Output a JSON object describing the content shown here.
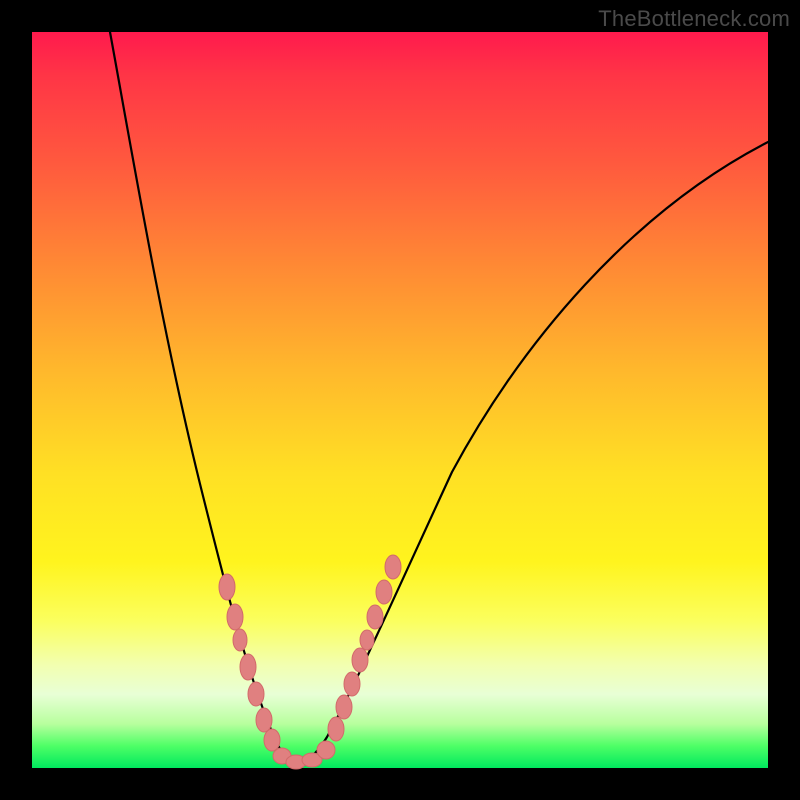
{
  "watermark": "TheBottleneck.com",
  "colors": {
    "frame": "#000000",
    "gradient_top": "#ff1a4d",
    "gradient_bottom": "#00e85e",
    "curve": "#000000",
    "bead": "#e08080"
  },
  "chart_data": {
    "type": "line",
    "title": "",
    "xlabel": "",
    "ylabel": "",
    "xlim": [
      0,
      100
    ],
    "ylim": [
      0,
      100
    ],
    "x": [
      0,
      2,
      4,
      6,
      8,
      10,
      12,
      14,
      16,
      18,
      20,
      22,
      24,
      26,
      27,
      28,
      29,
      30,
      31,
      32,
      33,
      34,
      35,
      36,
      38,
      40,
      42,
      45,
      48,
      52,
      56,
      60,
      64,
      68,
      72,
      76,
      80,
      84,
      88,
      92,
      96,
      100
    ],
    "values": [
      100,
      92,
      84,
      76,
      68,
      60,
      52,
      45,
      38,
      32,
      26,
      20,
      15,
      10,
      8,
      6,
      4,
      2.5,
      1.2,
      0.5,
      0.2,
      0,
      0.3,
      1,
      3,
      6,
      10,
      14,
      19,
      25,
      31,
      37,
      43,
      49,
      55,
      60,
      65,
      70,
      74,
      78,
      82,
      85
    ],
    "annotations": {
      "bead_cluster_left_x_range": [
        23,
        30
      ],
      "bead_cluster_right_x_range": [
        36,
        44
      ],
      "bead_cluster_bottom_x_range": [
        30,
        36
      ]
    }
  }
}
